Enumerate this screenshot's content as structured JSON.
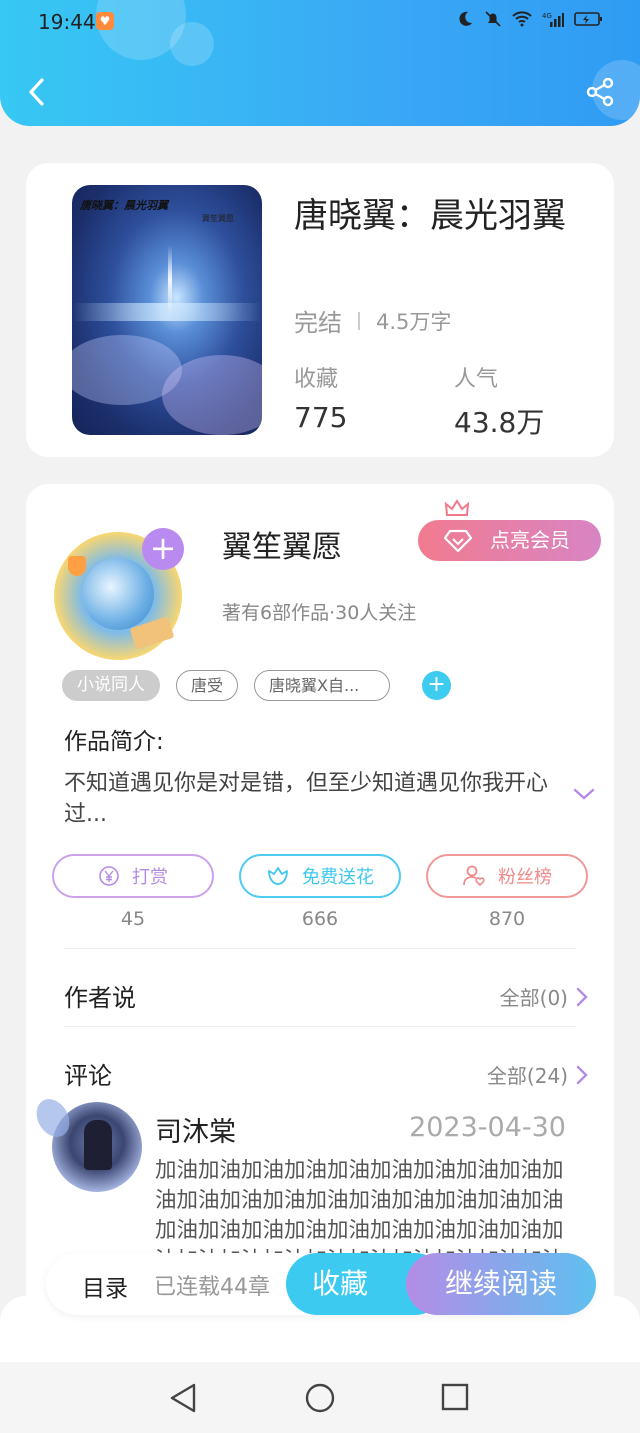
{
  "status_bar": {
    "time": "19:44",
    "network": "4G",
    "app_icon": "heart-badge-icon"
  },
  "book": {
    "title": "唐晓翼：晨光羽翼",
    "cover_title": "唐晓翼：晨光羽翼",
    "cover_subtitle": "翼笙翼愿",
    "status": "完结",
    "word_count": "4.5万字",
    "stats": [
      {
        "label": "收藏",
        "value": "775"
      },
      {
        "label": "人气",
        "value": "43.8万"
      }
    ]
  },
  "author": {
    "name": "翼笙翼愿",
    "summary": "著有6部作品·30人关注",
    "vip_label": "点亮会员"
  },
  "tags": [
    "小说同人",
    "唐受",
    "唐晓翼X自..."
  ],
  "intro": {
    "heading": "作品简介:",
    "text": "不知道遇见你是对是错，但至少知道遇见你我开心过..."
  },
  "actions": [
    {
      "label": "打赏",
      "count": "45",
      "color": "#c08fe0",
      "icon": "yuan-coin-icon"
    },
    {
      "label": "免费送花",
      "count": "666",
      "color": "#3ec8ef",
      "icon": "flower-icon"
    },
    {
      "label": "粉丝榜",
      "count": "870",
      "color": "#ef8a8a",
      "icon": "fan-user-icon"
    }
  ],
  "author_says": {
    "title": "作者说",
    "more": "全部(0)"
  },
  "comments": {
    "title": "评论",
    "more": "全部(24)",
    "items": [
      {
        "user": "司沐棠",
        "date": "2023-04-30",
        "text": "加油加油加油加油加油加油加油加油加油加油加油加油加油加油加油加油加油加油加油加油加油加油加油加油加油加油加油加油加油加油加油加油加油加油加油加油加油加油"
      }
    ]
  },
  "bottom_bar": {
    "catalog": "目录",
    "serial": "已连载44章",
    "collect": "收藏",
    "continue": "继续阅读"
  },
  "colors": {
    "header": "#37c8f3",
    "accent_blue": "#3ccaf1",
    "accent_purple": "#b48ce6",
    "vip_pink": "#f17b8f"
  }
}
